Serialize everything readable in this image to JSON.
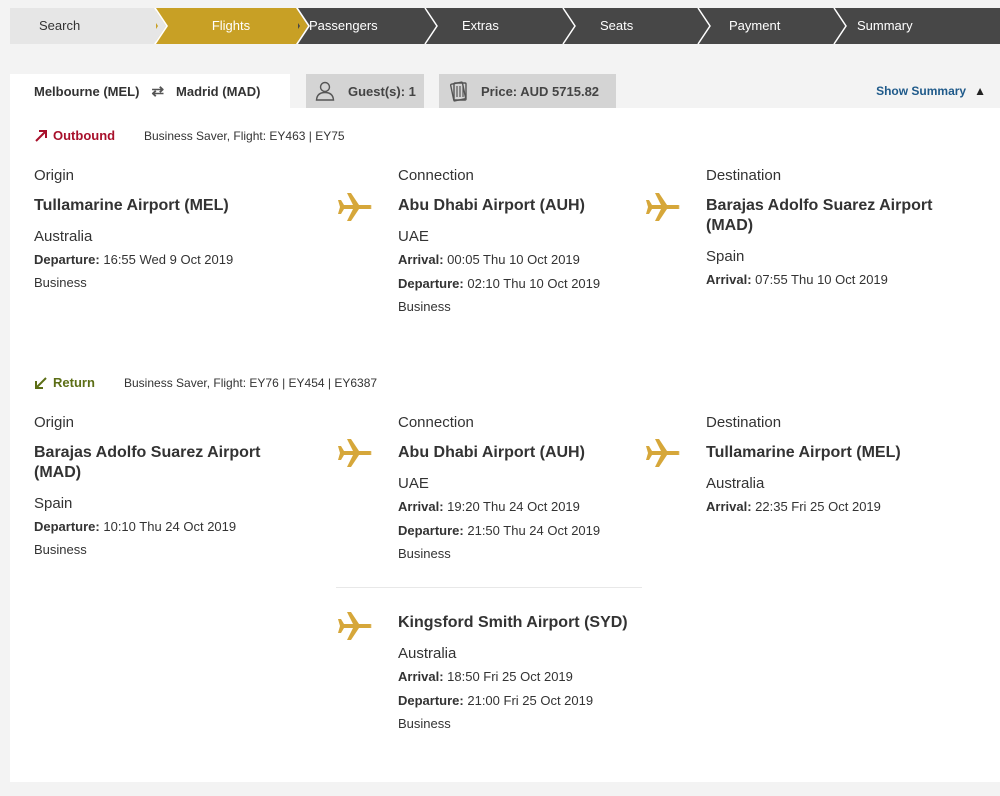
{
  "steps": [
    "Search",
    "Flights",
    "Passengers",
    "Extras",
    "Seats",
    "Payment",
    "Summary"
  ],
  "active_step": "Flights",
  "colors": {
    "accent": "#c8a025",
    "step_bg": "#474747",
    "outbound": "#a8102b",
    "return": "#5c6e16",
    "link": "#1f5a8a"
  },
  "summary": {
    "origin": "Melbourne (MEL)",
    "destination": "Madrid (MAD)",
    "guests": "Guest(s): 1",
    "price": "Price: AUD 5715.82",
    "show_summary": "Show Summary"
  },
  "outbound": {
    "label": "Outbound",
    "flight_info": "Business Saver, Flight: EY463 | EY75",
    "origin": {
      "label": "Origin",
      "airport": "Tullamarine Airport (MEL)",
      "country": "Australia",
      "departure_label": "Departure:",
      "departure": " 16:55 Wed 9 Oct 2019",
      "cabin": "Business"
    },
    "connection": {
      "label": "Connection",
      "airport": "Abu Dhabi Airport (AUH)",
      "country": "UAE",
      "arrival_label": "Arrival:",
      "arrival": " 00:05 Thu 10 Oct 2019",
      "departure_label": "Departure:",
      "departure": " 02:10 Thu 10 Oct 2019",
      "cabin": "Business"
    },
    "destination": {
      "label": "Destination",
      "airport": "Barajas Adolfo Suarez Airport (MAD)",
      "country": "Spain",
      "arrival_label": "Arrival:",
      "arrival": " 07:55 Thu 10 Oct 2019"
    }
  },
  "return": {
    "label": "Return",
    "flight_info": "Business Saver, Flight: EY76 | EY454 | EY6387",
    "origin": {
      "label": "Origin",
      "airport": "Barajas Adolfo Suarez Airport (MAD)",
      "country": "Spain",
      "departure_label": "Departure:",
      "departure": " 10:10 Thu 24 Oct 2019",
      "cabin": "Business"
    },
    "connection": {
      "label": "Connection",
      "airport": "Abu Dhabi Airport (AUH)",
      "country": "UAE",
      "arrival_label": "Arrival:",
      "arrival": " 19:20 Thu 24 Oct 2019",
      "departure_label": "Departure:",
      "departure": " 21:50 Thu 24 Oct 2019",
      "cabin": "Business"
    },
    "connection2": {
      "airport": "Kingsford Smith Airport (SYD)",
      "country": "Australia",
      "arrival_label": "Arrival:",
      "arrival": " 18:50 Fri 25 Oct 2019",
      "departure_label": "Departure:",
      "departure": " 21:00 Fri 25 Oct 2019",
      "cabin": "Business"
    },
    "destination": {
      "label": "Destination",
      "airport": "Tullamarine Airport (MEL)",
      "country": "Australia",
      "arrival_label": "Arrival:",
      "arrival": " 22:35 Fri 25 Oct 2019"
    }
  }
}
